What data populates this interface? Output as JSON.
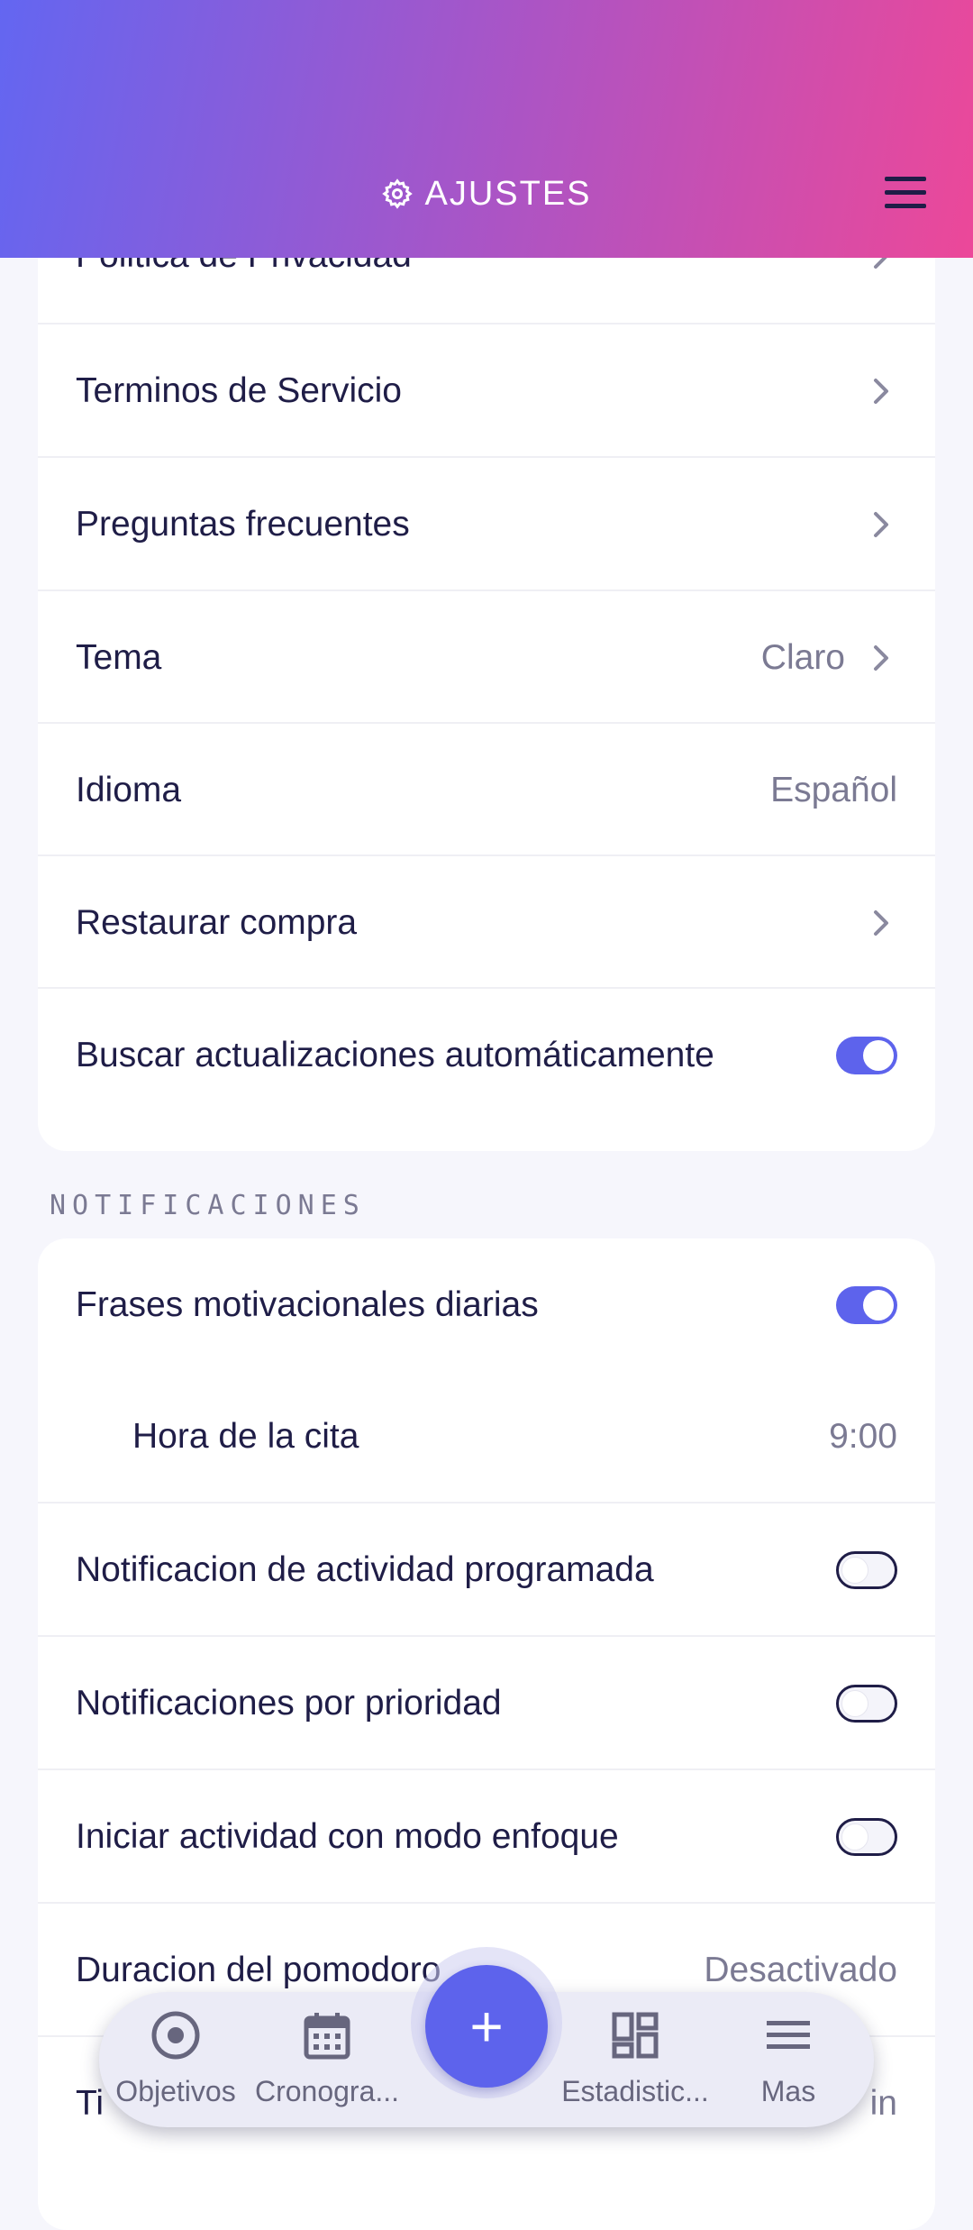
{
  "header": {
    "title": "AJUSTES",
    "icon": "gear-icon",
    "menu_icon": "hamburger-menu-icon"
  },
  "general_rows": [
    {
      "label": "Politica de Privacidad",
      "value": "",
      "chevron": true
    },
    {
      "label": "Terminos de Servicio",
      "value": "",
      "chevron": true
    },
    {
      "label": "Preguntas frecuentes",
      "value": "",
      "chevron": true
    },
    {
      "label": "Tema",
      "value": "Claro",
      "chevron": true
    },
    {
      "label": "Idioma",
      "value": "Español",
      "chevron": false
    },
    {
      "label": "Restaurar compra",
      "value": "",
      "chevron": true
    },
    {
      "label": "Buscar actualizaciones automáticamente",
      "toggle": true
    }
  ],
  "notifications": {
    "section_title": "NOTIFICACIONES",
    "rows": [
      {
        "label": "Frases motivacionales diarias",
        "toggle": true
      },
      {
        "label": "Hora de la cita",
        "value": "9:00"
      },
      {
        "label": "Notificacion de actividad programada",
        "toggle": false
      },
      {
        "label": "Notificaciones por prioridad",
        "toggle": false
      },
      {
        "label": "Iniciar actividad con modo enfoque",
        "toggle": false
      },
      {
        "label": "Duracion del pomodoro",
        "value": "Desactivado"
      },
      {
        "label": "Ti",
        "value": "in"
      }
    ]
  },
  "bottom_nav": {
    "items": [
      {
        "label": "Objetivos",
        "icon": "target-icon"
      },
      {
        "label": "Cronogra...",
        "icon": "calendar-icon"
      },
      {
        "label": "Estadistic...",
        "icon": "dashboard-icon"
      },
      {
        "label": "Mas",
        "icon": "menu-icon"
      }
    ],
    "fab_label": "+"
  },
  "colors": {
    "accent": "#5d63ec",
    "text": "#1f1d47",
    "muted": "#7b7a93",
    "gradient_start": "#6366f1",
    "gradient_end": "#ec4899"
  }
}
